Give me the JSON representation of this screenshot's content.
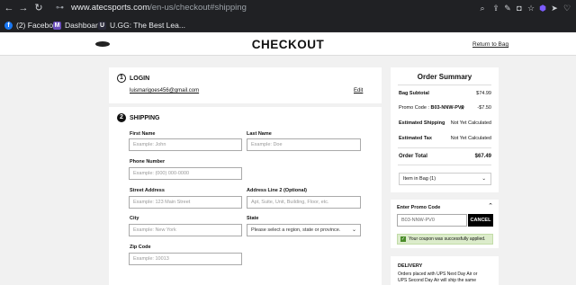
{
  "browser": {
    "url_domain": "www.atecsports.com",
    "url_path": "/en-us/checkout#shipping",
    "bookmarks": [
      {
        "label": "(2) Facebook",
        "color": "#1877f2",
        "glyph": "f"
      },
      {
        "label": "Dashboard",
        "color": "#6b4fbb",
        "glyph": "M"
      },
      {
        "label": "U.GG: The Best Lea...",
        "color": "#2a2a3a",
        "glyph": "U"
      }
    ]
  },
  "header": {
    "title": "CHECKOUT",
    "return_link": "Return to Bag"
  },
  "login": {
    "step": "1",
    "title": "LOGIN",
    "email": "luismarigoes456@gmail.com",
    "edit": "Edit"
  },
  "shipping": {
    "step": "2",
    "title": "SHIPPING",
    "first_name": {
      "label": "First Name",
      "placeholder": "Example: John"
    },
    "last_name": {
      "label": "Last Name",
      "placeholder": "Example: Doe"
    },
    "phone": {
      "label": "Phone Number",
      "placeholder": "Example: (000) 000-0000"
    },
    "street": {
      "label": "Street Address",
      "placeholder": "Example: 123 Main Street"
    },
    "address2": {
      "label": "Address Line 2 (Optional)",
      "placeholder": "Apt, Suite, Unit, Building, Floor, etc."
    },
    "city": {
      "label": "City",
      "placeholder": "Example: New York"
    },
    "state": {
      "label": "State",
      "value": "Please select a region, state or province."
    },
    "zip": {
      "label": "Zip Code",
      "placeholder": "Example: 10013"
    }
  },
  "summary": {
    "title": "Order Summary",
    "bag_subtotal_label": "Bag Subtotal",
    "bag_subtotal": "$74.99",
    "promo_label": "Promo Code :",
    "promo_code": "B03-NNW-PV0",
    "promo_discount": "-$7.50",
    "est_shipping_label": "Estimated Shipping",
    "est_shipping": "Not Yet Calculated",
    "est_tax_label": "Estimated Tax",
    "est_tax": "Not Yet Calculated",
    "order_total_label": "Order Total",
    "order_total": "$67.49",
    "item_in_bag": "Item in Bag (1)"
  },
  "promo": {
    "title": "Enter Promo Code",
    "value": "B03-NNW-PV0",
    "cancel_label": "CANCEL",
    "success_message": "Your coupon was successfully applied."
  },
  "delivery": {
    "title": "DELIVERY",
    "text_line1": "Orders placed with UPS Next Day Air or",
    "text_line2": "UPS Second Day Air will ship the same"
  }
}
